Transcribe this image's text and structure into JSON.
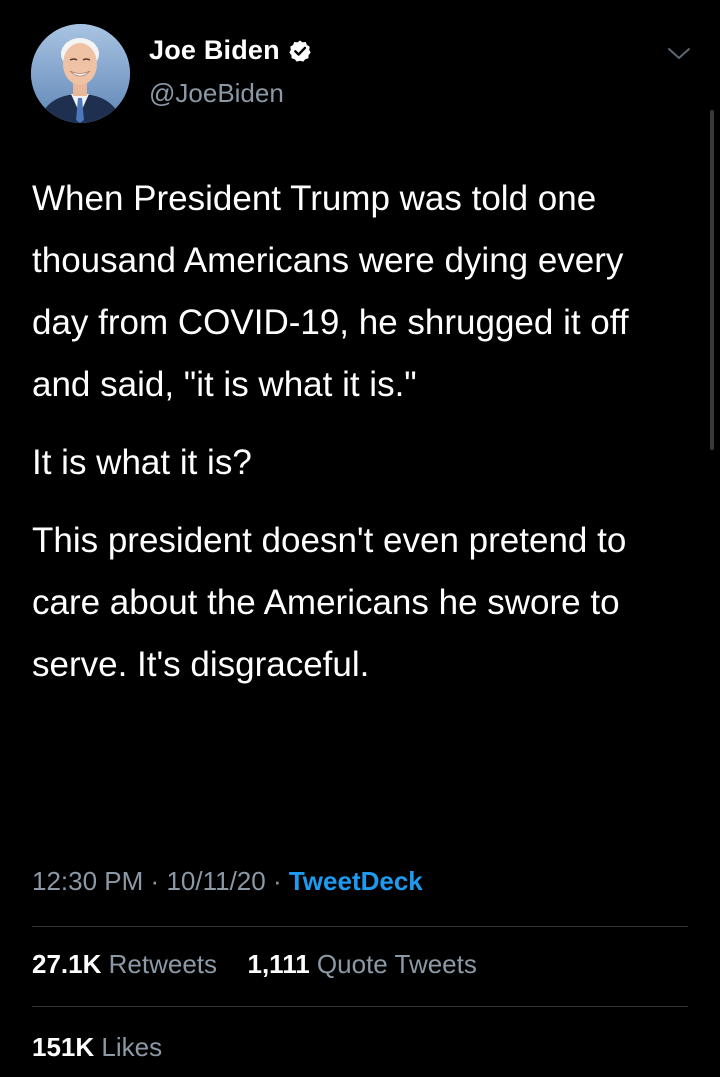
{
  "author": {
    "display_name": "Joe Biden",
    "handle": "@JoeBiden",
    "verified": true,
    "avatar_icon": "profile-photo"
  },
  "tweet": {
    "paragraphs": [
      "When President Trump was told one thousand Americans were dying every day from COVID-19, he shrugged it off and said, \"it is what it is.\"",
      "It is what it is?",
      "This president doesn't even pretend to care about the Americans he swore to serve. It's disgraceful."
    ],
    "time": "12:30 PM",
    "separator": "·",
    "date": "10/11/20",
    "source": "TweetDeck"
  },
  "stats": {
    "retweets_count": "27.1K",
    "retweets_label": "Retweets",
    "quote_count": "1,111",
    "quote_label": "Quote Tweets",
    "likes_count": "151K",
    "likes_label": "Likes"
  },
  "colors": {
    "background": "#000000",
    "text": "#ffffff",
    "secondary_text": "#8b98a5",
    "link": "#1d9bf0",
    "divider": "#2f3336"
  }
}
